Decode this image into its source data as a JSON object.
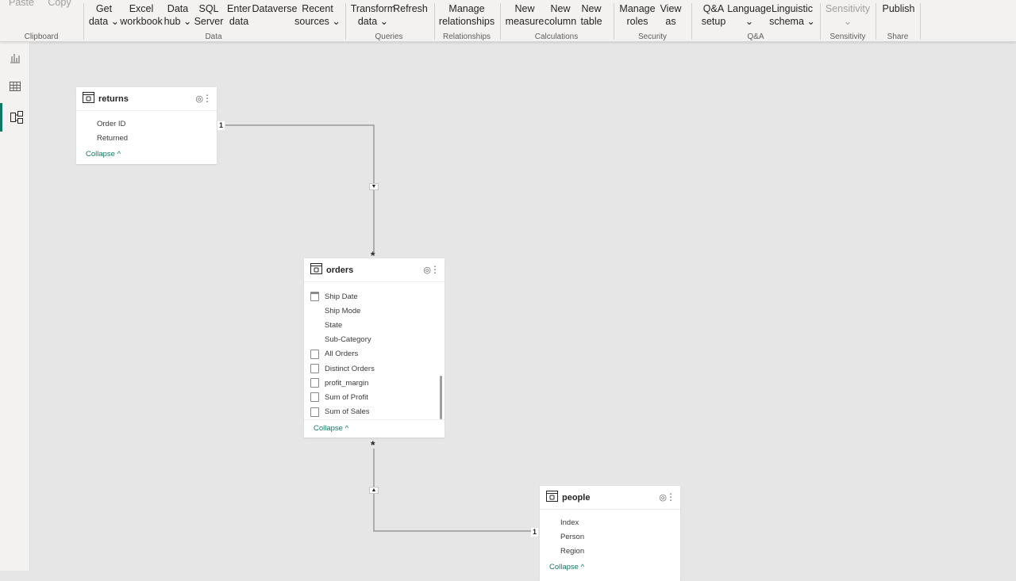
{
  "ribbon": {
    "buttons": [
      {
        "id": "paste",
        "l1": "Paste",
        "l2": "",
        "disabled": true
      },
      {
        "id": "copy",
        "l1": "Copy",
        "l2": "",
        "disabled": true
      },
      {
        "id": "get-data",
        "l1": "Get",
        "l2": "data ⌄"
      },
      {
        "id": "excel-workbook",
        "l1": "Excel",
        "l2": "workbook"
      },
      {
        "id": "data-hub",
        "l1": "Data",
        "l2": "hub ⌄"
      },
      {
        "id": "sql-server",
        "l1": "SQL",
        "l2": "Server"
      },
      {
        "id": "enter-data",
        "l1": "Enter",
        "l2": "data"
      },
      {
        "id": "dataverse",
        "l1": "Dataverse",
        "l2": ""
      },
      {
        "id": "recent-sources",
        "l1": "Recent",
        "l2": "sources ⌄"
      },
      {
        "id": "transform-data",
        "l1": "Transform",
        "l2": "data ⌄"
      },
      {
        "id": "refresh",
        "l1": "Refresh",
        "l2": ""
      },
      {
        "id": "manage-relationships",
        "l1": "Manage",
        "l2": "relationships"
      },
      {
        "id": "new-measure",
        "l1": "New",
        "l2": "measure"
      },
      {
        "id": "new-column",
        "l1": "New",
        "l2": "column"
      },
      {
        "id": "new-table",
        "l1": "New",
        "l2": "table"
      },
      {
        "id": "manage-roles",
        "l1": "Manage",
        "l2": "roles"
      },
      {
        "id": "view-as",
        "l1": "View",
        "l2": "as"
      },
      {
        "id": "qa-setup",
        "l1": "Q&A",
        "l2": "setup"
      },
      {
        "id": "language",
        "l1": "Language",
        "l2": "⌄"
      },
      {
        "id": "linguistic-schema",
        "l1": "Linguistic",
        "l2": "schema ⌄"
      },
      {
        "id": "sensitivity",
        "l1": "Sensitivity",
        "l2": "⌄",
        "disabled": true
      },
      {
        "id": "publish",
        "l1": "Publish",
        "l2": ""
      }
    ],
    "groups": [
      "Clipboard",
      "Data",
      "Queries",
      "Relationships",
      "Calculations",
      "Security",
      "Q&A",
      "Sensitivity",
      "Share"
    ]
  },
  "tables": {
    "returns": {
      "name": "returns",
      "fields": [
        {
          "name": "Order ID",
          "icon": ""
        },
        {
          "name": "Returned",
          "icon": ""
        }
      ],
      "collapse": "Collapse ^"
    },
    "orders": {
      "name": "orders",
      "fields": [
        {
          "name": "Ship Date",
          "icon": "calendar"
        },
        {
          "name": "Ship Mode",
          "icon": ""
        },
        {
          "name": "State",
          "icon": ""
        },
        {
          "name": "Sub-Category",
          "icon": ""
        },
        {
          "name": "All Orders",
          "icon": "calculator"
        },
        {
          "name": "Distinct Orders",
          "icon": "calculator"
        },
        {
          "name": "profit_margin",
          "icon": "calculator"
        },
        {
          "name": "Sum of Profit",
          "icon": "calculator"
        },
        {
          "name": "Sum of Sales",
          "icon": "calculator"
        }
      ],
      "collapse": "Collapse ^"
    },
    "people": {
      "name": "people",
      "fields": [
        {
          "name": "Index",
          "icon": ""
        },
        {
          "name": "Person",
          "icon": ""
        },
        {
          "name": "Region",
          "icon": ""
        }
      ],
      "collapse": "Collapse ^"
    }
  },
  "relationships": {
    "one": "1",
    "many": "*"
  },
  "colors": {
    "accent": "#117865",
    "canvas": "#e6e6e6",
    "ribbon": "#f3f2f1"
  }
}
